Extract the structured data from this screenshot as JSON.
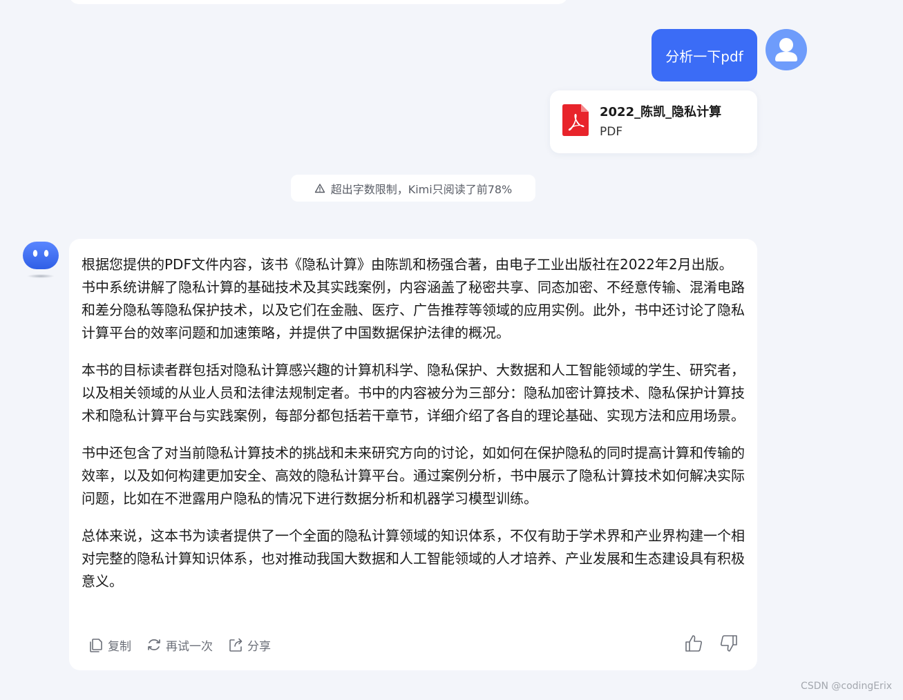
{
  "user_message": {
    "text": "分析一下pdf"
  },
  "attachment": {
    "name": "2022_陈凯_隐私计算",
    "type": "PDF"
  },
  "notice": {
    "text": "超出字数限制，Kimi只阅读了前78%"
  },
  "answer": {
    "paragraphs": [
      "根据您提供的PDF文件内容，该书《隐私计算》由陈凯和杨强合著，由电子工业出版社在2022年2月出版。书中系统讲解了隐私计算的基础技术及其实践案例，内容涵盖了秘密共享、同态加密、不经意传输、混淆电路和差分隐私等隐私保护技术，以及它们在金融、医疗、广告推荐等领域的应用实例。此外，书中还讨论了隐私计算平台的效率问题和加速策略，并提供了中国数据保护法律的概况。",
      "本书的目标读者群包括对隐私计算感兴趣的计算机科学、隐私保护、大数据和人工智能领域的学生、研究者，以及相关领域的从业人员和法律法规制定者。书中的内容被分为三部分：隐私加密计算技术、隐私保护计算技术和隐私计算平台与实践案例，每部分都包括若干章节，详细介绍了各自的理论基础、实现方法和应用场景。",
      "书中还包含了对当前隐私计算技术的挑战和未来研究方向的讨论，如如何在保护隐私的同时提高计算和传输的效率，以及如何构建更加安全、高效的隐私计算平台。通过案例分析，书中展示了隐私计算技术如何解决实际问题，比如在不泄露用户隐私的情况下进行数据分析和机器学习模型训练。",
      "总体来说，这本书为读者提供了一个全面的隐私计算领域的知识体系，不仅有助于学术界和产业界构建一个相对完整的隐私计算知识体系，也对推动我国大数据和人工智能领域的人才培养、产业发展和生态建设具有积极意义。"
    ]
  },
  "actions": {
    "copy": "复制",
    "retry": "再试一次",
    "share": "分享"
  },
  "watermark": "CSDN @codingErix",
  "icons": {
    "user_avatar": "user-icon",
    "file": "pdf-file-icon",
    "warning": "warning-triangle-icon",
    "bot": "kimi-bot-icon",
    "copy": "copy-icon",
    "retry": "refresh-icon",
    "share": "share-icon",
    "like": "thumbs-up-icon",
    "dislike": "thumbs-down-icon"
  },
  "colors": {
    "accent": "#3b6cf6",
    "avatar": "#6e9cfb",
    "pdf_red": "#e8242b",
    "background": "#f3f5fa"
  }
}
